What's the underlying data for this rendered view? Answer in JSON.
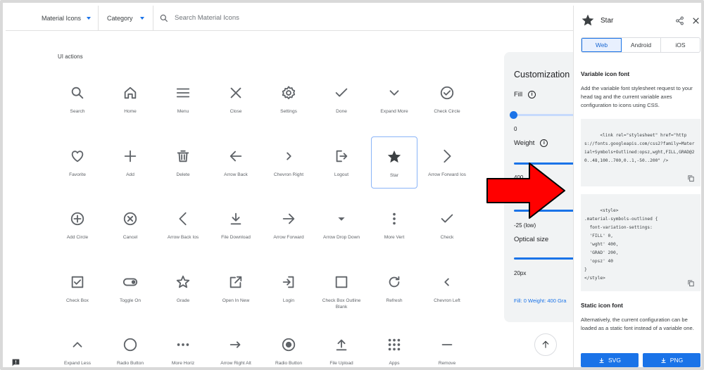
{
  "topbar": {
    "family_select": "Material Icons",
    "category_select": "Category",
    "search_placeholder": "Search Material Icons"
  },
  "section_title": "UI actions",
  "icons": [
    {
      "label": "Search",
      "icon": "search-icon"
    },
    {
      "label": "Home",
      "icon": "home-icon"
    },
    {
      "label": "Menu",
      "icon": "menu-icon"
    },
    {
      "label": "Close",
      "icon": "close-icon"
    },
    {
      "label": "Settings",
      "icon": "settings-icon"
    },
    {
      "label": "Done",
      "icon": "done-icon"
    },
    {
      "label": "Expand More",
      "icon": "expand-more-icon"
    },
    {
      "label": "Check Circle",
      "icon": "check-circle-icon"
    },
    {
      "label": "Favorite",
      "icon": "favorite-icon"
    },
    {
      "label": "Add",
      "icon": "add-icon"
    },
    {
      "label": "Delete",
      "icon": "delete-icon"
    },
    {
      "label": "Arrow Back",
      "icon": "arrow-back-icon"
    },
    {
      "label": "Chevron Right",
      "icon": "chevron-right-icon"
    },
    {
      "label": "Logout",
      "icon": "logout-icon"
    },
    {
      "label": "Star",
      "icon": "star-icon",
      "selected": true
    },
    {
      "label": "Arrow Forward Ios",
      "icon": "arrow-forward-ios-icon"
    },
    {
      "label": "Add Circle",
      "icon": "add-circle-icon"
    },
    {
      "label": "Cancel",
      "icon": "cancel-icon"
    },
    {
      "label": "Arrow Back Ios",
      "icon": "arrow-back-ios-icon"
    },
    {
      "label": "File Download",
      "icon": "file-download-icon"
    },
    {
      "label": "Arrow Forward",
      "icon": "arrow-forward-icon"
    },
    {
      "label": "Arrow Drop Down",
      "icon": "arrow-drop-down-icon"
    },
    {
      "label": "More Vert",
      "icon": "more-vert-icon"
    },
    {
      "label": "Check",
      "icon": "check-icon"
    },
    {
      "label": "Check Box",
      "icon": "check-box-icon"
    },
    {
      "label": "Toggle On",
      "icon": "toggle-on-icon"
    },
    {
      "label": "Grade",
      "icon": "grade-icon"
    },
    {
      "label": "Open In New",
      "icon": "open-in-new-icon"
    },
    {
      "label": "Login",
      "icon": "login-icon"
    },
    {
      "label": "Check Box Outline Blank",
      "icon": "check-box-outline-blank-icon"
    },
    {
      "label": "Refresh",
      "icon": "refresh-icon"
    },
    {
      "label": "Chevron Left",
      "icon": "chevron-left-icon"
    },
    {
      "label": "Expand Less",
      "icon": "expand-less-icon"
    },
    {
      "label": "Radio Button",
      "icon": "radio-button-unchecked-icon"
    },
    {
      "label": "More Horiz",
      "icon": "more-horiz-icon"
    },
    {
      "label": "Arrow Right Alt",
      "icon": "arrow-right-alt-icon"
    },
    {
      "label": "Radio Button",
      "icon": "radio-button-checked-icon"
    },
    {
      "label": "File Upload",
      "icon": "file-upload-icon"
    },
    {
      "label": "Apps",
      "icon": "apps-icon"
    },
    {
      "label": "Remove",
      "icon": "remove-icon"
    }
  ],
  "customization": {
    "title": "Customization",
    "fill_label": "Fill",
    "fill_value": "0",
    "weight_label": "Weight",
    "weight_value": "400",
    "grade_value": "-25 (low)",
    "optical_label": "Optical size",
    "optical_value": "20px",
    "summary": "Fill: 0 Weight: 400 Gra"
  },
  "side_panel": {
    "title": "Star",
    "tabs": [
      "Web",
      "Android",
      "iOS"
    ],
    "active_tab": "Web",
    "variable_heading": "Variable icon font",
    "variable_text": "Add the variable font stylesheet request to your head tag and the current variable axes configuration to icons using CSS.",
    "code_link": "<link rel=\"stylesheet\" href=\"https://fonts.googleapis.com/css2?family=Material+Symbols+Outlined:opsz,wght,FILL,GRAD@20..48,100..700,0..1,-50..200\" />",
    "code_style": "<style>\n.material-symbols-outlined {\n  font-variation-settings:\n  'FILL' 0,\n  'wght' 400,\n  'GRAD' 200,\n  'opsz' 40\n}\n</style>",
    "static_heading": "Static icon font",
    "static_text": "Alternatively, the current configuration can be loaded as a static font instead of a variable one.",
    "svg_button": "SVG",
    "png_button": "PNG"
  },
  "colors": {
    "accent": "#1a73e8",
    "icon": "#5f6368",
    "arrow_fill": "#ff0000",
    "arrow_stroke": "#000000"
  }
}
